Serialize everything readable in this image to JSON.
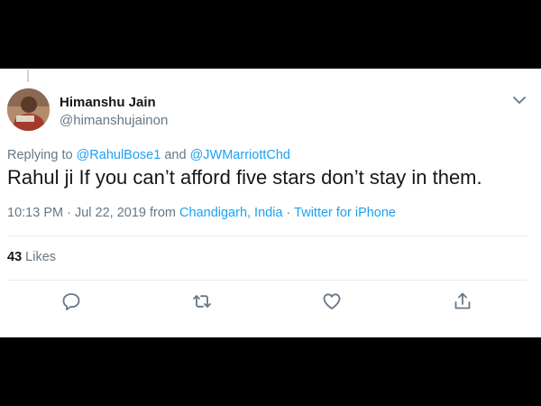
{
  "user": {
    "name": "Himanshu Jain",
    "handle": "@himanshujainon"
  },
  "reply": {
    "prefix": "Replying to",
    "mention1": "@RahulBose1",
    "joiner": "and",
    "mention2": "@JWMarriottChd"
  },
  "tweet": {
    "text": "Rahul ji If you can’t afford five stars don’t stay in them."
  },
  "meta": {
    "time": "10:13 PM · Jul 22, 2019 from",
    "location": "Chandigarh, India",
    "separator": "·",
    "source": "Twitter for iPhone"
  },
  "stats": {
    "likes_count": "43",
    "likes_label": "Likes"
  },
  "icons": {
    "menu": "chevron-down-icon",
    "reply": "reply-icon",
    "retweet": "retweet-icon",
    "like": "heart-icon",
    "share": "share-icon"
  },
  "colors": {
    "link": "#1da1f2",
    "secondary_text": "#657786",
    "primary_text": "#14171a",
    "background": "#000000"
  }
}
